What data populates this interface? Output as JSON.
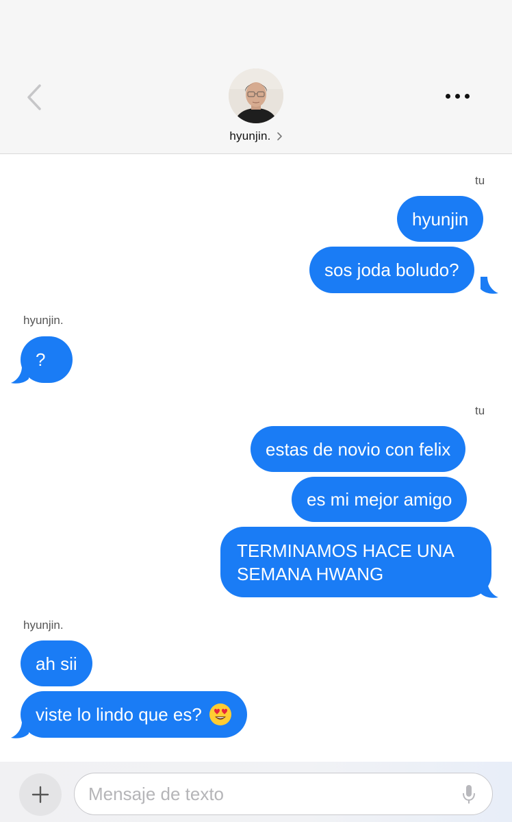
{
  "header": {
    "contact_name": "hyunjin.",
    "back_icon": "chevron-left-icon",
    "more_icon": "more-horizontal-icon",
    "name_chevron_icon": "chevron-right-icon"
  },
  "messages": {
    "group1_sender": "tu",
    "m1": "hyunjin",
    "m2": "sos joda boludo?",
    "group2_sender": "hyunjin.",
    "m3": "?",
    "group3_sender": "tu",
    "m4": "estas de novio con felix",
    "m5": "es mi mejor amigo",
    "m6": "TERMINAMOS HACE UNA SEMANA HWANG",
    "group4_sender": "hyunjin.",
    "m7": "ah sii",
    "m8": "viste lo lindo que es?",
    "m8_emoji": "heart-eyes-emoji"
  },
  "composer": {
    "placeholder": "Mensaje de texto",
    "value": "",
    "plus_icon": "plus-icon",
    "mic_icon": "microphone-icon"
  },
  "colors": {
    "bubble": "#1a7cf5",
    "header_bg": "#f6f6f6",
    "back_chevron": "#c6c6c8"
  }
}
